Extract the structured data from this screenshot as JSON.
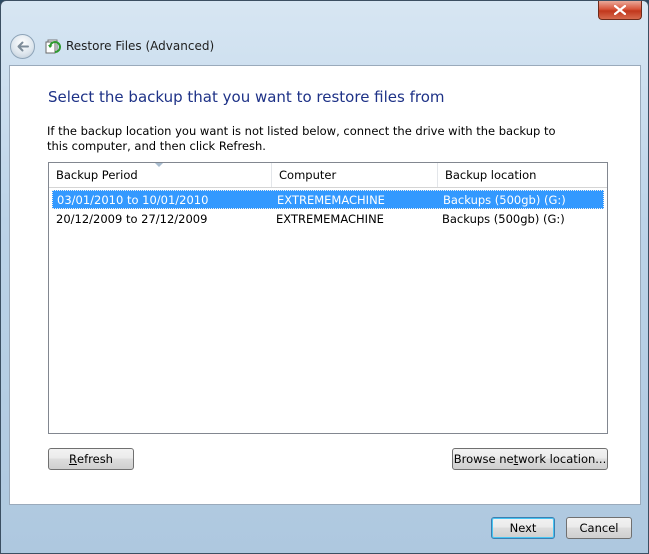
{
  "window": {
    "title": "Restore Files (Advanced)",
    "close_icon": "close-x-icon",
    "back_icon": "back-arrow-icon",
    "app_icon": "restore-files-icon"
  },
  "page": {
    "heading": "Select the backup that you want to restore files from",
    "instructions": "If the backup location you want is not listed below, connect the drive with the backup to this computer, and then click Refresh."
  },
  "table": {
    "columns": [
      "Backup Period",
      "Computer",
      "Backup location"
    ],
    "sorted_column": "Backup Period",
    "rows": [
      {
        "period": "03/01/2010 to 10/01/2010",
        "computer": "EXTREMEMACHINE",
        "location": "Backups (500gb) (G:)",
        "selected": true
      },
      {
        "period": "20/12/2009 to 27/12/2009",
        "computer": "EXTREMEMACHINE",
        "location": "Backups (500gb) (G:)",
        "selected": false
      }
    ]
  },
  "buttons": {
    "refresh": {
      "access_key": "R",
      "rest": "efresh"
    },
    "browse": {
      "pre": "Browse ne",
      "access_key": "t",
      "post": "work location..."
    },
    "next": "Next",
    "cancel": "Cancel"
  },
  "colors": {
    "heading": "#1e3287",
    "selection": "#3399ff"
  }
}
